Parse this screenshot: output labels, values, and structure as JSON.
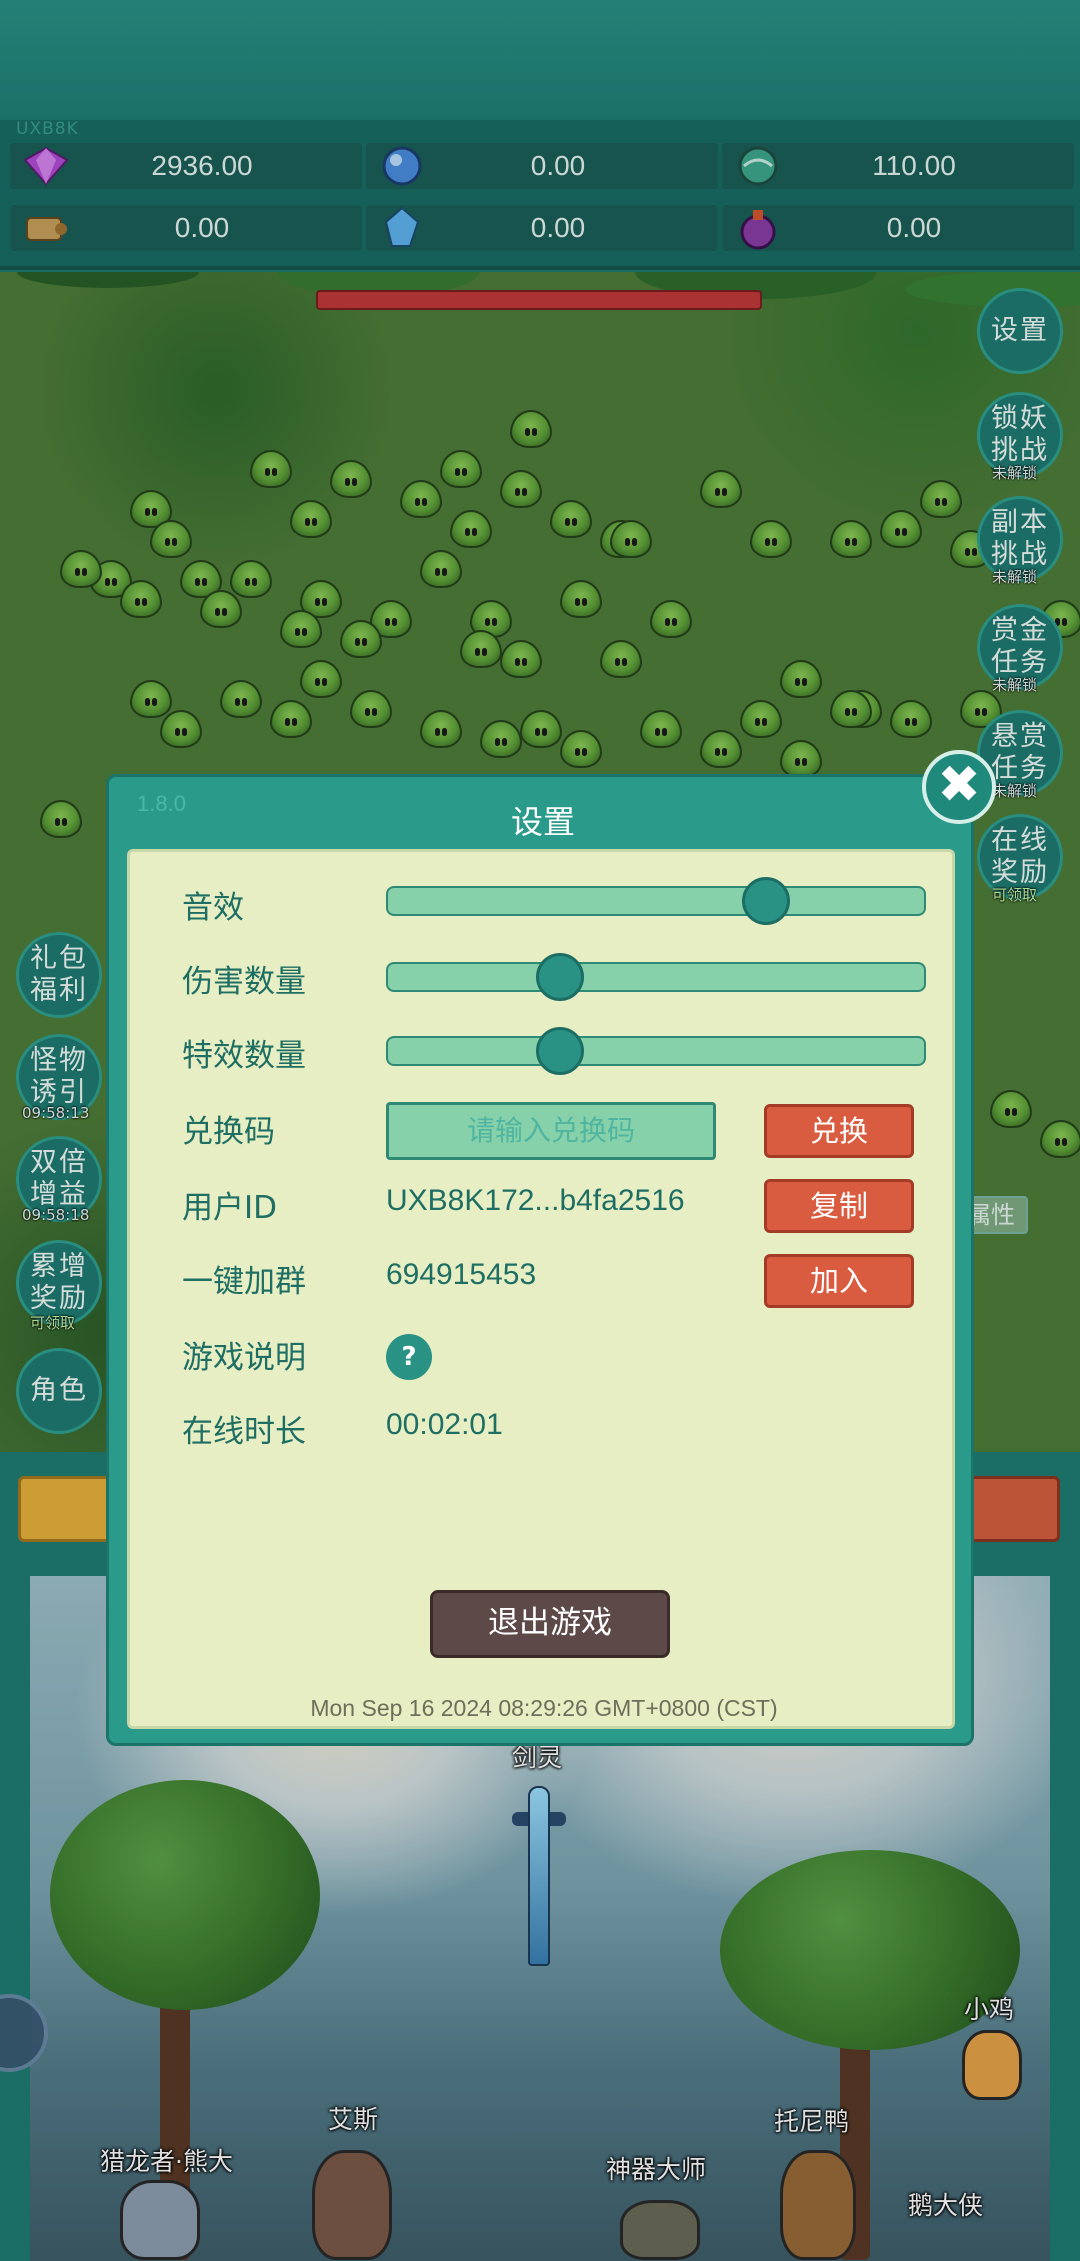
{
  "header": {
    "player_tag": "UXB8K"
  },
  "resources": [
    {
      "icon": "purple-gem-icon",
      "value": "2936.00",
      "color": "#b34dd8"
    },
    {
      "icon": "blue-crystal-icon",
      "value": "0.00",
      "color": "#4a8fe0"
    },
    {
      "icon": "teal-orb-icon",
      "value": "110.00",
      "color": "#3ea88e"
    },
    {
      "icon": "scroll-icon",
      "value": "0.00",
      "color": "#c9a15c"
    },
    {
      "icon": "ice-shard-icon",
      "value": "0.00",
      "color": "#5fb4f0"
    },
    {
      "icon": "purple-potion-icon",
      "value": "0.00",
      "color": "#8a3fa8"
    }
  ],
  "side_right": [
    {
      "label": "设置",
      "sub": ""
    },
    {
      "label": "锁妖挑战",
      "sub": "未解锁"
    },
    {
      "label": "副本挑战",
      "sub": "未解锁"
    },
    {
      "label": "赏金任务",
      "sub": "未解锁"
    },
    {
      "label": "悬赏任务",
      "sub": "未解锁"
    },
    {
      "label": "在线奖励",
      "sub": "可领取"
    }
  ],
  "side_left": [
    {
      "label": "礼包福利",
      "sub": ""
    },
    {
      "label": "怪物诱引",
      "sub": "09:58:13"
    },
    {
      "label": "双倍增益",
      "sub": "09:58:18"
    },
    {
      "label": "累增奖励",
      "sub": "可领取"
    },
    {
      "label": "角色",
      "sub": ""
    }
  ],
  "attr_tag": "属性",
  "scene": {
    "characters": [
      {
        "name": "猎龙者·熊大"
      },
      {
        "name": "艾斯"
      },
      {
        "name": "神器大师"
      },
      {
        "name": "托尼鸭"
      },
      {
        "name": "鹅大侠"
      },
      {
        "name": "小鸡"
      },
      {
        "name": "剑灵"
      }
    ]
  },
  "settings_modal": {
    "version": "1.8.0",
    "title": "设置",
    "rows": {
      "sound_label": "音效",
      "damage_label": "伤害数量",
      "effects_label": "特效数量",
      "redeem_label": "兑换码",
      "redeem_placeholder": "请输入兑换码",
      "redeem_button": "兑换",
      "user_id_label": "用户ID",
      "user_id_value": "UXB8K172...b4fa2516",
      "copy_button": "复制",
      "group_label": "一键加群",
      "group_value": "694915453",
      "join_button": "加入",
      "guide_label": "游戏说明",
      "guide_icon_glyph": "?",
      "online_label": "在线时长",
      "online_value": "00:02:01"
    },
    "sliders": {
      "sound_level": 0.72,
      "damage_level": 0.3,
      "effects_level": 0.3
    },
    "exit_button": "退出游戏",
    "datetime": "Mon Sep 16 2024 08:29:26 GMT+0800 (CST)",
    "close_glyph": "✖"
  }
}
